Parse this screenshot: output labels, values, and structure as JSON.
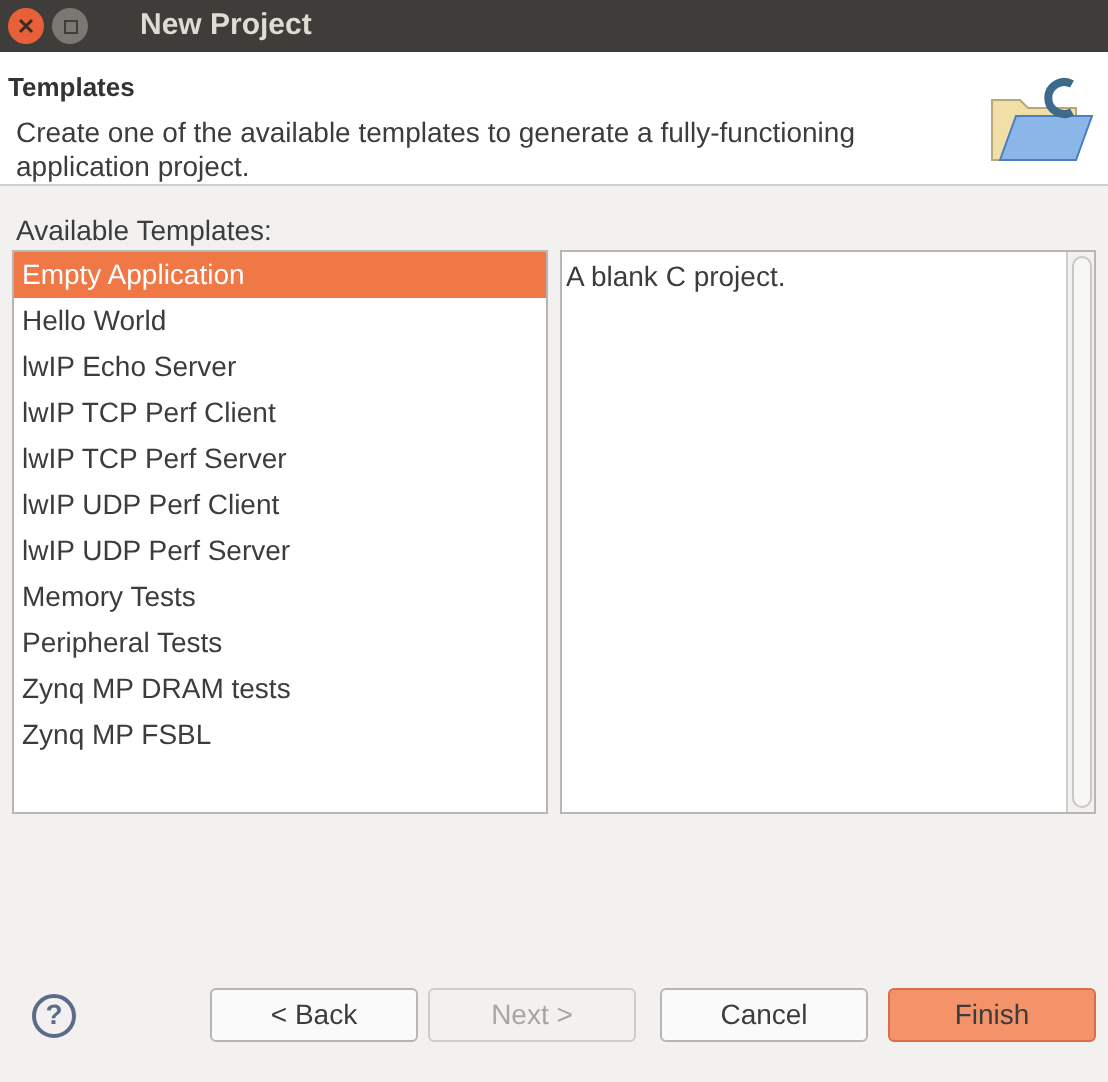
{
  "window": {
    "title": "New Project"
  },
  "header": {
    "title": "Templates",
    "description": "Create one of the available templates to generate a fully-functioning application project."
  },
  "templates_label": "Available Templates:",
  "templates": [
    {
      "label": "Empty Application",
      "selected": true
    },
    {
      "label": "Hello World",
      "selected": false
    },
    {
      "label": "lwIP Echo Server",
      "selected": false
    },
    {
      "label": "lwIP TCP Perf Client",
      "selected": false
    },
    {
      "label": "lwIP TCP Perf Server",
      "selected": false
    },
    {
      "label": "lwIP UDP Perf Client",
      "selected": false
    },
    {
      "label": "lwIP UDP Perf Server",
      "selected": false
    },
    {
      "label": "Memory Tests",
      "selected": false
    },
    {
      "label": "Peripheral Tests",
      "selected": false
    },
    {
      "label": "Zynq MP DRAM tests",
      "selected": false
    },
    {
      "label": "Zynq MP FSBL",
      "selected": false
    }
  ],
  "description_text": "A blank C project.",
  "help_button": "?",
  "buttons": [
    {
      "label": "< Back",
      "disabled": false,
      "default": false
    },
    {
      "label": "Next >",
      "disabled": true,
      "default": false
    },
    {
      "label": "Cancel",
      "disabled": false,
      "default": false
    },
    {
      "label": "Finish",
      "disabled": false,
      "default": true
    }
  ]
}
